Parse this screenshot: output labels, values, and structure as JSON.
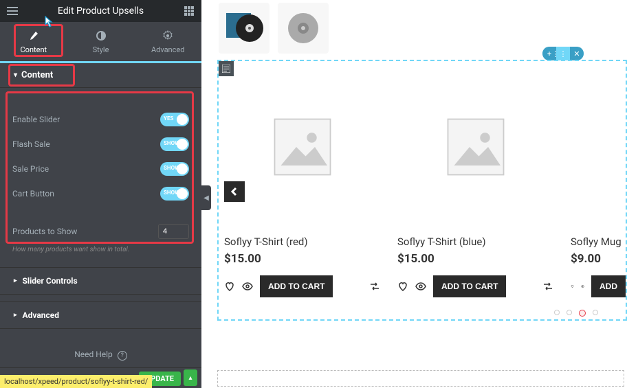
{
  "page_title": "Edit Product Upsells",
  "tabs": {
    "content": "Content",
    "style": "Style",
    "advanced": "Advanced"
  },
  "section_content": "Content",
  "controls": {
    "enable_slider": {
      "label": "Enable Slider",
      "value": "YES"
    },
    "flash_sale": {
      "label": "Flash Sale",
      "value": "SHOW"
    },
    "sale_price": {
      "label": "Sale Price",
      "value": "SHOW"
    },
    "cart_button": {
      "label": "Cart Button",
      "value": "SHOW"
    },
    "products_to_show": {
      "label": "Products to Show",
      "value": "4"
    },
    "hint": "How many products want show in total."
  },
  "accordion": {
    "slider_controls": "Slider Controls",
    "advanced": "Advanced"
  },
  "need_help": "Need Help",
  "update_btn": "UPDATE",
  "url": "localhost/xpeed/product/soflyy-t-shirt-red/",
  "products": [
    {
      "name": "Soflyy T-Shirt (red)",
      "price": "$15.00",
      "btn": "ADD TO CART"
    },
    {
      "name": "Soflyy T-Shirt (blue)",
      "price": "$15.00",
      "btn": "ADD TO CART"
    },
    {
      "name": "Soflyy Mug",
      "price": "$9.00",
      "btn": "ADD"
    }
  ]
}
